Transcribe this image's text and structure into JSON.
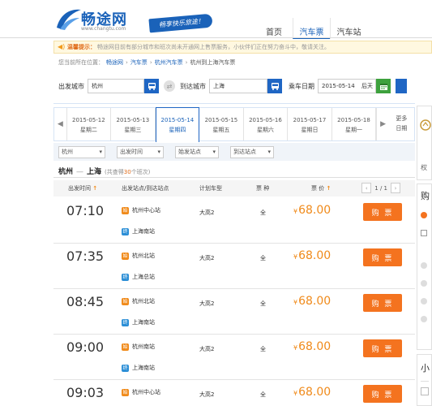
{
  "header": {
    "logo_text": "畅途网",
    "logo_url": "www.changtu.com",
    "slogan": "畅享快乐旅途！",
    "nav": [
      {
        "label": "首页",
        "active": false
      },
      {
        "label": "汽车票",
        "active": true
      },
      {
        "label": "汽车站",
        "active": false
      }
    ]
  },
  "notice": {
    "title": "温馨提示：",
    "text": "畅途网目前有部分城市和班次尚未开通网上售票服务，小伙伴们正在努力奋斗中，敬请关注。"
  },
  "breadcrumb": {
    "prefix": "您当前所在位置：",
    "items": [
      "畅途网",
      "汽车票",
      "杭州汽车票"
    ],
    "current": "杭州到上海汽车票",
    "sep": "›"
  },
  "search": {
    "from_label": "出发城市",
    "from_value": "杭州",
    "to_label": "到达城市",
    "to_value": "上海",
    "date_label": "乘车日期",
    "date_value": "2015-05-14",
    "date_hint": "后天",
    "swap": "⇄"
  },
  "dates": [
    {
      "date": "2015-05-12",
      "weekday": "星期二",
      "active": false
    },
    {
      "date": "2015-05-13",
      "weekday": "星期三",
      "active": false
    },
    {
      "date": "2015-05-14",
      "weekday": "星期四",
      "active": true
    },
    {
      "date": "2015-05-15",
      "weekday": "星期五",
      "active": false
    },
    {
      "date": "2015-05-16",
      "weekday": "星期六",
      "active": false
    },
    {
      "date": "2015-05-17",
      "weekday": "星期日",
      "active": false
    },
    {
      "date": "2015-05-18",
      "weekday": "星期一",
      "active": false
    }
  ],
  "more_dates": {
    "line1": "更多",
    "line2": "日期"
  },
  "filters": [
    "杭州",
    "出发时间",
    "始发站点",
    "到达站点"
  ],
  "route": {
    "from": "杭州",
    "to": "上海",
    "dash": "—",
    "count_prefix": "(共查得",
    "count": "30",
    "count_suffix": "个班次)"
  },
  "table": {
    "headers": {
      "time": "出发时间",
      "station": "出发站点/到达站点",
      "type": "计划车型",
      "kind": "票 种",
      "price": "票 价"
    },
    "sort_arrow": "↑",
    "pager": {
      "prev": "‹",
      "text": "1 / 1",
      "next": "›"
    },
    "buy_label": "购 票",
    "currency": "¥",
    "rows": [
      {
        "time": "07:10",
        "dep": "杭州中心站",
        "arr": "上海南站",
        "type": "大高2",
        "kind": "全",
        "price": "68.00"
      },
      {
        "time": "07:35",
        "dep": "杭州北站",
        "arr": "上海总站",
        "type": "大高2",
        "kind": "全",
        "price": "68.00"
      },
      {
        "time": "08:45",
        "dep": "杭州北站",
        "arr": "上海南站",
        "type": "大高2",
        "kind": "全",
        "price": "68.00"
      },
      {
        "time": "09:00",
        "dep": "杭州南站",
        "arr": "上海南站",
        "type": "大高2",
        "kind": "全",
        "price": "68.00"
      },
      {
        "time": "09:03",
        "dep": "杭州中心站",
        "arr": "",
        "type": "大高2",
        "kind": "全",
        "price": "68.00"
      }
    ],
    "dep_badge": "始",
    "arr_badge": "终"
  },
  "sidebar": {
    "tag1": "权",
    "tag2": "购",
    "tag3": "小"
  },
  "colors": {
    "brand": "#1a62b9",
    "accent": "#f4731f",
    "price": "#f08a1a"
  }
}
